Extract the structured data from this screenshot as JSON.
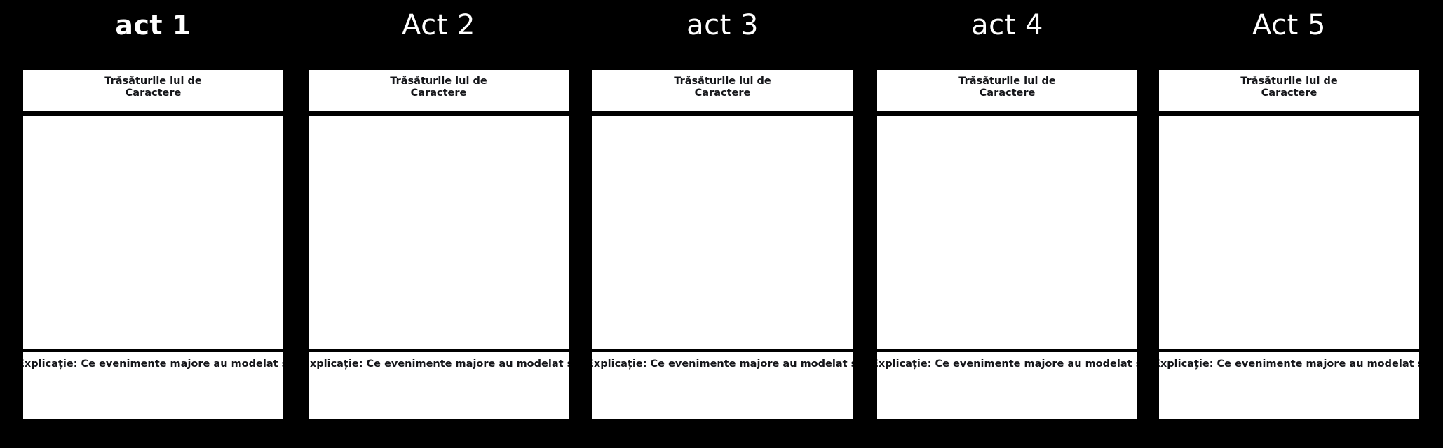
{
  "background_color": "#000000",
  "panel_background": "#ffffff",
  "text_color": "#15161a",
  "title_color": "#ffffff",
  "panels": [
    {
      "title": "act 1",
      "header_text": "Trăsăturile lui de\nCaractere",
      "footer_text": "Explicație: Ce evenimente majore au modelat sau schimbat caracterul",
      "image_placeholder": ""
    },
    {
      "title": "Act 2",
      "header_text": "Trăsăturile lui de\nCaractere",
      "footer_text": "Explicație: Ce evenimente majore au modelat sau schimbat caracterul",
      "image_placeholder": ""
    },
    {
      "title": "act 3",
      "header_text": "Trăsăturile lui de\nCaractere",
      "footer_text": "Explicație: Ce evenimente majore au modelat sau schimbat caracterul",
      "image_placeholder": ""
    },
    {
      "title": "act 4",
      "header_text": "Trăsăturile lui de\nCaractere",
      "footer_text": "Explicație: Ce evenimente majore au modelat sau schimbat caracterul",
      "image_placeholder": ""
    },
    {
      "title": "Act 5",
      "header_text": "Trăsăturile lui de\nCaractere",
      "footer_text": "Explicație: Ce evenimente majore au modelat sau schimbat caracterul",
      "image_placeholder": ""
    }
  ]
}
